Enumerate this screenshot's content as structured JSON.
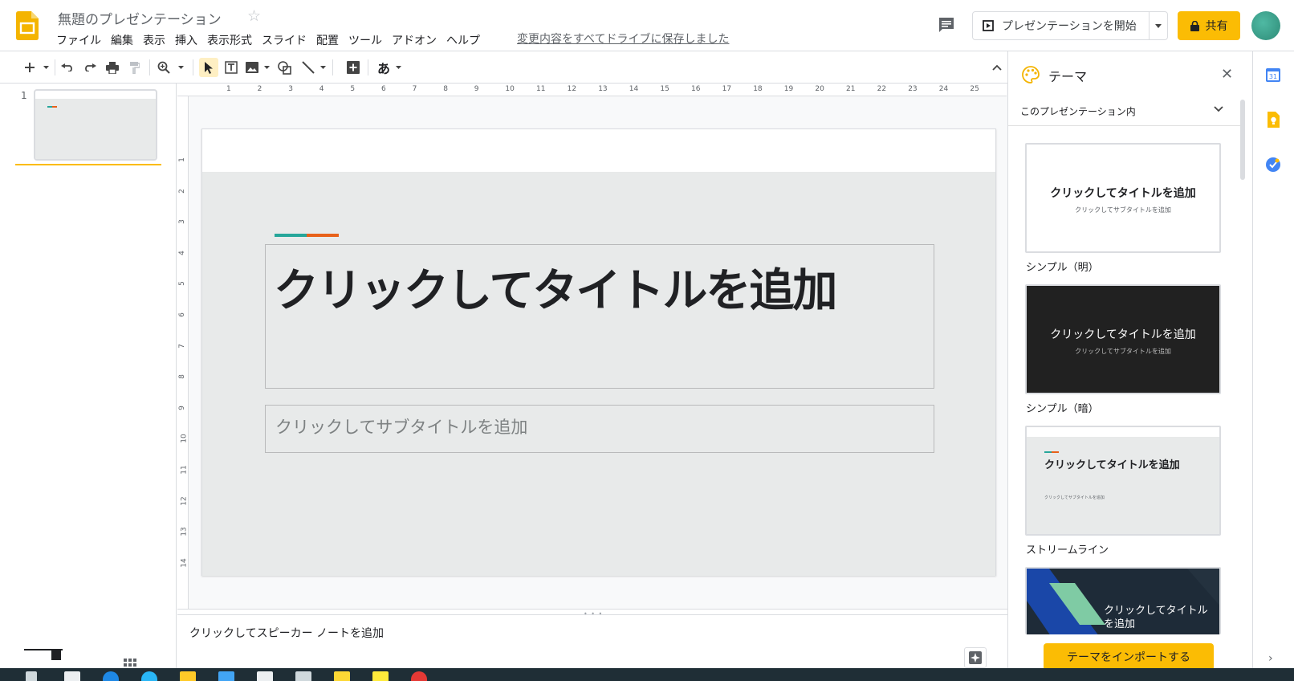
{
  "header": {
    "doc_title": "無題のプレゼンテーション",
    "save_status": "変更内容をすべてドライブに保存しました",
    "present_label": "プレゼンテーションを開始",
    "share_label": "共有"
  },
  "menu": [
    "ファイル",
    "編集",
    "表示",
    "挿入",
    "表示形式",
    "スライド",
    "配置",
    "ツール",
    "アドオン",
    "ヘルプ"
  ],
  "toolbar": {
    "input_tool_label": "あ"
  },
  "filmstrip": {
    "slide_number": "1"
  },
  "ruler": {
    "horizontal": [
      "1",
      "2",
      "3",
      "4",
      "5",
      "6",
      "7",
      "8",
      "9",
      "10",
      "11",
      "12",
      "13",
      "14",
      "15",
      "16",
      "17",
      "18",
      "19",
      "20",
      "21",
      "22",
      "23",
      "24",
      "25"
    ],
    "vertical": [
      "1",
      "2",
      "3",
      "4",
      "5",
      "6",
      "7",
      "8",
      "9",
      "10",
      "11",
      "12",
      "13",
      "14"
    ]
  },
  "slide": {
    "title_placeholder": "クリックしてタイトルを追加",
    "subtitle_placeholder": "クリックしてサブタイトルを追加"
  },
  "notes": {
    "placeholder": "クリックしてスピーカー ノートを追加"
  },
  "theme_panel": {
    "title": "テーマ",
    "scope": "このプレゼンテーション内",
    "themes": [
      {
        "name": "シンプル（明）",
        "title": "クリックしてタイトルを追加",
        "subtitle": "クリックしてサブタイトルを追加"
      },
      {
        "name": "シンプル（暗）",
        "title": "クリックしてタイトルを追加",
        "subtitle": "クリックしてサブタイトルを追加"
      },
      {
        "name": "ストリームライン",
        "title": "クリックしてタイトルを追加",
        "subtitle": "クリックしてサブタイトルを追加"
      },
      {
        "title": "クリックしてタイトルを追加"
      }
    ],
    "import_label": "テーマをインポートする"
  },
  "colors": {
    "accent": "#fbbc04",
    "teal": "#26a69a",
    "orange": "#e8611a",
    "slide_bg": "#e8eaea"
  }
}
